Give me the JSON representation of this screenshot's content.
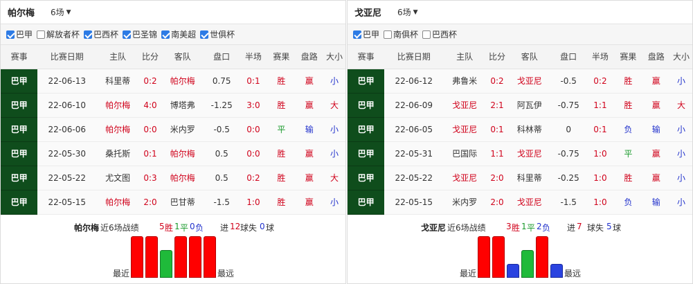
{
  "columns": [
    "赛事",
    "比赛日期",
    "主队",
    "比分",
    "客队",
    "盘口",
    "半场",
    "赛果",
    "盘路",
    "大小"
  ],
  "colors": {
    "league_bg": "#0f4d1c",
    "win": "#ff0000",
    "draw": "#1fba3a",
    "loss": "#2a43e0",
    "checkbox": "#2d7be5"
  },
  "panels": [
    {
      "team": "帕尔梅",
      "matches_select": "6场",
      "filters": [
        {
          "label": "巴甲",
          "checked": true
        },
        {
          "label": "解放者杯",
          "checked": false
        },
        {
          "label": "巴西杯",
          "checked": true
        },
        {
          "label": "巴圣锦",
          "checked": true
        },
        {
          "label": "南美超",
          "checked": true
        },
        {
          "label": "世俱杯",
          "checked": true
        }
      ],
      "rows": [
        {
          "league": "巴甲",
          "date": "22-06-13",
          "home": "科里蒂",
          "score": "0:2",
          "away": "帕尔梅",
          "handicap": "0.75",
          "half": "0:1",
          "result": "胜",
          "pan": "赢",
          "ou": "小"
        },
        {
          "league": "巴甲",
          "date": "22-06-10",
          "home": "帕尔梅",
          "score": "4:0",
          "away": "博塔弗",
          "handicap": "-1.25",
          "half": "3:0",
          "result": "胜",
          "pan": "赢",
          "ou": "大"
        },
        {
          "league": "巴甲",
          "date": "22-06-06",
          "home": "帕尔梅",
          "score": "0:0",
          "away": "米内罗",
          "handicap": "-0.5",
          "half": "0:0",
          "result": "平",
          "pan": "输",
          "ou": "小"
        },
        {
          "league": "巴甲",
          "date": "22-05-30",
          "home": "桑托斯",
          "score": "0:1",
          "away": "帕尔梅",
          "handicap": "0.5",
          "half": "0:0",
          "result": "胜",
          "pan": "赢",
          "ou": "小"
        },
        {
          "league": "巴甲",
          "date": "22-05-22",
          "home": "尤文图",
          "score": "0:3",
          "away": "帕尔梅",
          "handicap": "0.5",
          "half": "0:2",
          "result": "胜",
          "pan": "赢",
          "ou": "大"
        },
        {
          "league": "巴甲",
          "date": "22-05-15",
          "home": "帕尔梅",
          "score": "2:0",
          "away": "巴甘蒂",
          "handicap": "-1.5",
          "half": "1:0",
          "result": "胜",
          "pan": "赢",
          "ou": "小"
        }
      ],
      "summary": {
        "team": "帕尔梅",
        "label": "近6场战绩",
        "win": "5",
        "win_u": "胜",
        "draw": "1",
        "draw_u": "平",
        "loss": "0",
        "loss_u": "负",
        "gf_pre": "进",
        "gf": "12",
        "gf_u": "球失",
        "ga": "0",
        "ga_u": "球"
      },
      "chart_data": {
        "type": "bar",
        "categories": [
          "1",
          "2",
          "3",
          "4",
          "5",
          "6"
        ],
        "values": [
          3,
          3,
          2,
          3,
          3,
          3
        ],
        "colors": [
          "win",
          "win",
          "draw",
          "win",
          "win",
          "win"
        ],
        "left_label": "最近",
        "right_label": "最远"
      }
    },
    {
      "team": "戈亚尼",
      "matches_select": "6场",
      "filters": [
        {
          "label": "巴甲",
          "checked": true
        },
        {
          "label": "南俱杯",
          "checked": false
        },
        {
          "label": "巴西杯",
          "checked": false
        }
      ],
      "rows": [
        {
          "league": "巴甲",
          "date": "22-06-12",
          "home": "弗鲁米",
          "score": "0:2",
          "away": "戈亚尼",
          "handicap": "-0.5",
          "half": "0:2",
          "result": "胜",
          "pan": "赢",
          "ou": "小"
        },
        {
          "league": "巴甲",
          "date": "22-06-09",
          "home": "戈亚尼",
          "score": "2:1",
          "away": "阿瓦伊",
          "handicap": "-0.75",
          "half": "1:1",
          "result": "胜",
          "pan": "赢",
          "ou": "大"
        },
        {
          "league": "巴甲",
          "date": "22-06-05",
          "home": "戈亚尼",
          "score": "0:1",
          "away": "科林蒂",
          "handicap": "0",
          "half": "0:1",
          "result": "负",
          "pan": "输",
          "ou": "小"
        },
        {
          "league": "巴甲",
          "date": "22-05-31",
          "home": "巴国际",
          "score": "1:1",
          "away": "戈亚尼",
          "handicap": "-0.75",
          "half": "1:0",
          "result": "平",
          "pan": "赢",
          "ou": "小"
        },
        {
          "league": "巴甲",
          "date": "22-05-22",
          "home": "戈亚尼",
          "score": "2:0",
          "away": "科里蒂",
          "handicap": "-0.25",
          "half": "1:0",
          "result": "胜",
          "pan": "赢",
          "ou": "小"
        },
        {
          "league": "巴甲",
          "date": "22-05-15",
          "home": "米内罗",
          "score": "2:0",
          "away": "戈亚尼",
          "handicap": "-1.5",
          "half": "1:0",
          "result": "负",
          "pan": "输",
          "ou": "小"
        }
      ],
      "summary": {
        "team": "戈亚尼",
        "label": "近6场战绩",
        "win": "3",
        "win_u": "胜",
        "draw": "1",
        "draw_u": "平",
        "loss": "2",
        "loss_u": "负",
        "gf_pre": "进",
        "gf": "7",
        "gf_u": "球失",
        "ga": "5",
        "ga_u": "球"
      },
      "chart_data": {
        "type": "bar",
        "categories": [
          "1",
          "2",
          "3",
          "4",
          "5",
          "6"
        ],
        "values": [
          3,
          3,
          1,
          2,
          3,
          1
        ],
        "colors": [
          "win",
          "win",
          "loss",
          "draw",
          "win",
          "loss"
        ],
        "left_label": "最近",
        "right_label": "最远"
      }
    }
  ]
}
